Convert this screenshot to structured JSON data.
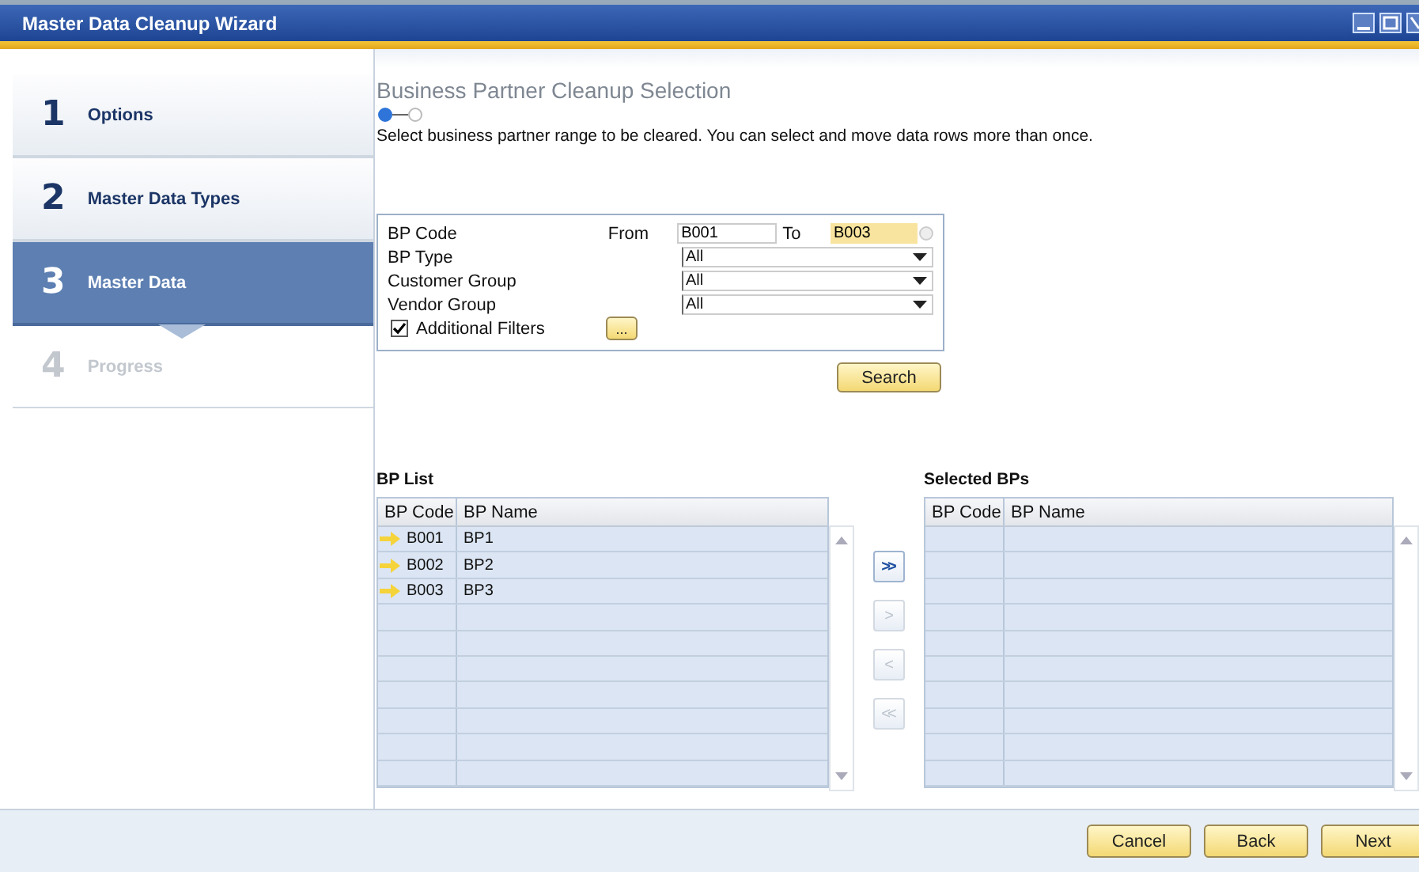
{
  "window": {
    "title": "Master Data Cleanup Wizard"
  },
  "steps": [
    {
      "number": "1",
      "label": "Options",
      "selected": false,
      "disabled": false
    },
    {
      "number": "2",
      "label": "Master Data Types",
      "selected": false,
      "disabled": false
    },
    {
      "number": "3",
      "label": "Master Data",
      "selected": true,
      "disabled": false
    },
    {
      "number": "4",
      "label": "Progress",
      "selected": false,
      "disabled": true
    }
  ],
  "page": {
    "title": "Business Partner Cleanup Selection",
    "progress_dots": [
      {
        "selected": true
      },
      {
        "selected": false
      }
    ],
    "instruction": "Select business partner range to be cleared. You can select and move data rows more than once."
  },
  "filters": {
    "bp_code": {
      "label": "BP Code",
      "from_label": "From",
      "from_value": "B001",
      "to_label": "To",
      "to_value": "B003"
    },
    "dropdowns": [
      {
        "label": "BP Type",
        "value": "All"
      },
      {
        "label": "Customer Group",
        "value": "All"
      },
      {
        "label": "Vendor Group",
        "value": "All"
      }
    ],
    "additional_filters": {
      "label": "Additional Filters",
      "checked": true,
      "button": "..."
    },
    "search_button": "Search"
  },
  "bp_list": {
    "title": "BP List",
    "columns": [
      "BP Code",
      "BP Name"
    ],
    "rows": [
      {
        "code": "B001",
        "name": "BP1"
      },
      {
        "code": "B002",
        "name": "BP2"
      },
      {
        "code": "B003",
        "name": "BP3"
      }
    ]
  },
  "transfer_buttons": [
    {
      "label": ">>",
      "disabled": false
    },
    {
      "label": ">",
      "disabled": true
    },
    {
      "label": "<",
      "disabled": true
    },
    {
      "label": "<<",
      "disabled": true
    }
  ],
  "selected_bps": {
    "title": "Selected BPs",
    "columns": [
      "BP Code",
      "BP Name"
    ]
  },
  "footer_buttons": [
    "Cancel",
    "Back",
    "Next"
  ]
}
